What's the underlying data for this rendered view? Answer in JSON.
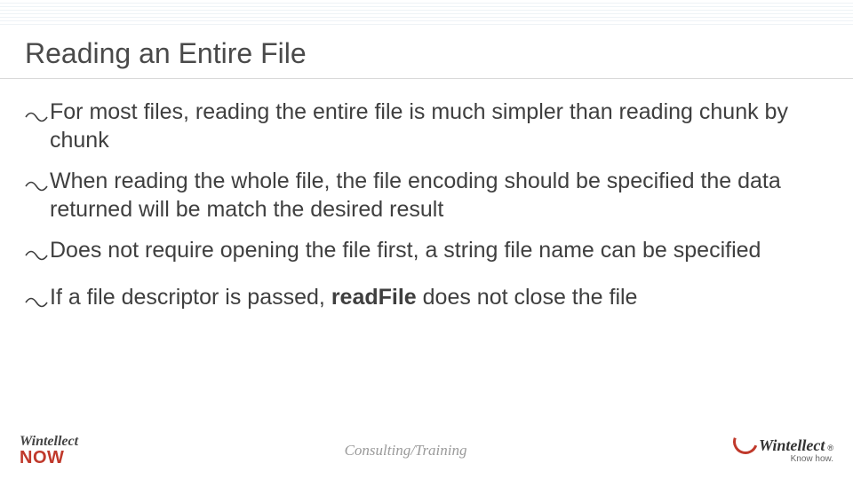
{
  "title": "Reading an Entire File",
  "bullets": [
    {
      "text": "For most files, reading the entire file is much simpler than reading chunk by chunk"
    },
    {
      "text": "When reading the whole file, the file encoding should be specified the data returned will be match the desired result"
    },
    {
      "text": "Does not require opening the file first, a string file name can be specified"
    },
    {
      "pre": "If a file descriptor is passed, ",
      "bold": "readFile",
      "post": " does not close the file"
    }
  ],
  "footer": {
    "left_top": "Wintellect",
    "left_bottom": "NOW",
    "center": "Consulting/Training",
    "right_name": "Wintellect",
    "right_reg": "®",
    "right_tag": "Know how."
  }
}
